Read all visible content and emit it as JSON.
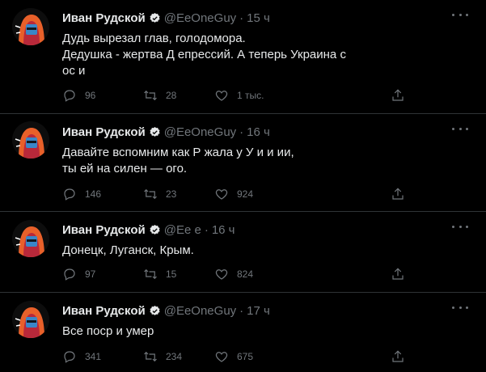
{
  "colors": {
    "background": "#000000",
    "text": "#e7e9ea",
    "muted": "#71767b",
    "divider": "#2f3336",
    "verified": "#1d9bf0"
  },
  "icons": [
    "avatar-hooded-figure",
    "verified-badge-icon",
    "more-icon",
    "reply-icon",
    "retweet-icon",
    "like-icon",
    "share-icon"
  ],
  "tweets": [
    {
      "name": "Иван Рудской",
      "handle": "@EeOneGuy",
      "time": "15 ч",
      "lines": [
        "Дудь вырезал глав,                                          голодомора.",
        "Дедушка - жертва       Д  епрессий. А теперь Украина               с",
        "  ос  и"
      ],
      "replies": "96",
      "retweets": "28",
      "likes": "1 тыс."
    },
    {
      "name": "Иван Рудской",
      "handle": "@EeOneGuy",
      "time": "16 ч",
      "lines": [
        "Давайте вспомним как Р   жала у У      и      и   ии,",
        "ты           ей              на                      силен  —      ого."
      ],
      "replies": "146",
      "retweets": "23",
      "likes": "924"
    },
    {
      "name": "Иван Рудской",
      "handle": "@Ee   e",
      "time": "16 ч",
      "lines": [
        "Донецк, Луганск, Крым."
      ],
      "replies": "97",
      "retweets": "15",
      "likes": "824"
    },
    {
      "name": "Иван Рудской",
      "handle": "@EeOneGuy",
      "time": "17 ч",
      "lines": [
        "Все поср       и             умер"
      ],
      "replies": "341",
      "retweets": "234",
      "likes": "675"
    }
  ]
}
